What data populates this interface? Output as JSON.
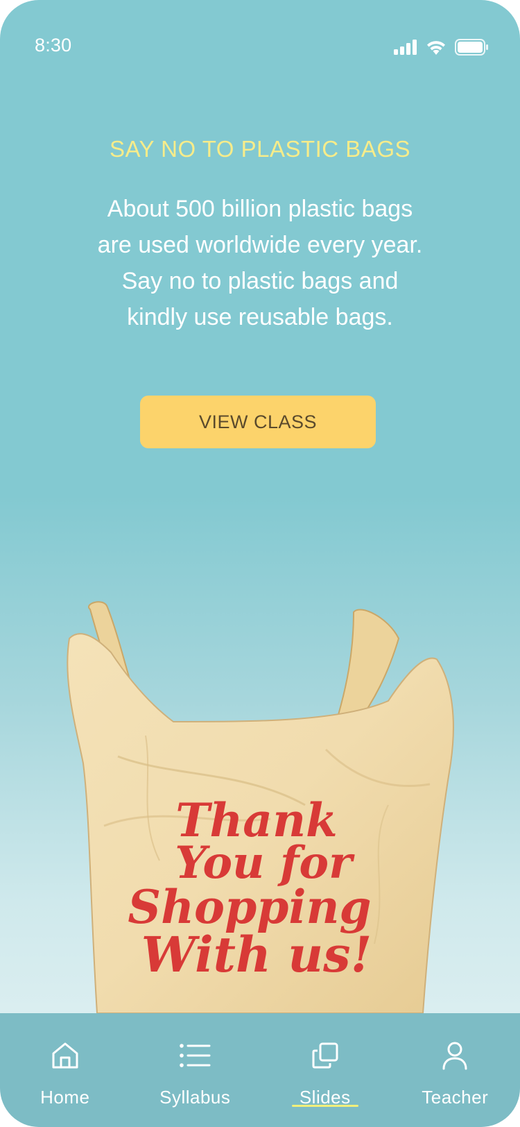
{
  "status_bar": {
    "time": "8:30",
    "icons": [
      "signal-icon",
      "wifi-icon",
      "battery-icon"
    ]
  },
  "main": {
    "headline": "SAY NO TO PLASTIC BAGS",
    "body_lines": [
      "About 500 billion plastic bags",
      "are used worldwide every year.",
      "Say no to plastic bags and",
      "kindly use reusable bags."
    ],
    "cta_label": "VIEW CLASS"
  },
  "illustration": {
    "icon": "plastic-bag-image",
    "bag_text": [
      "Thank",
      "You for",
      "Shopping",
      "With us!"
    ]
  },
  "bottom_nav": {
    "items": [
      {
        "label": "Home",
        "icon": "home-icon"
      },
      {
        "label": "Syllabus",
        "icon": "list-icon"
      },
      {
        "label": "Slides",
        "icon": "slides-icon",
        "active": true
      },
      {
        "label": "Teacher",
        "icon": "person-icon"
      }
    ]
  },
  "colors": {
    "background_top": "#83c9d1",
    "headline": "#f7ec8a",
    "cta_background": "#fcd36b",
    "cta_text": "#5a4a2c",
    "nav_background": "#7dbcc5",
    "active_underline": "#f1ef7a"
  }
}
